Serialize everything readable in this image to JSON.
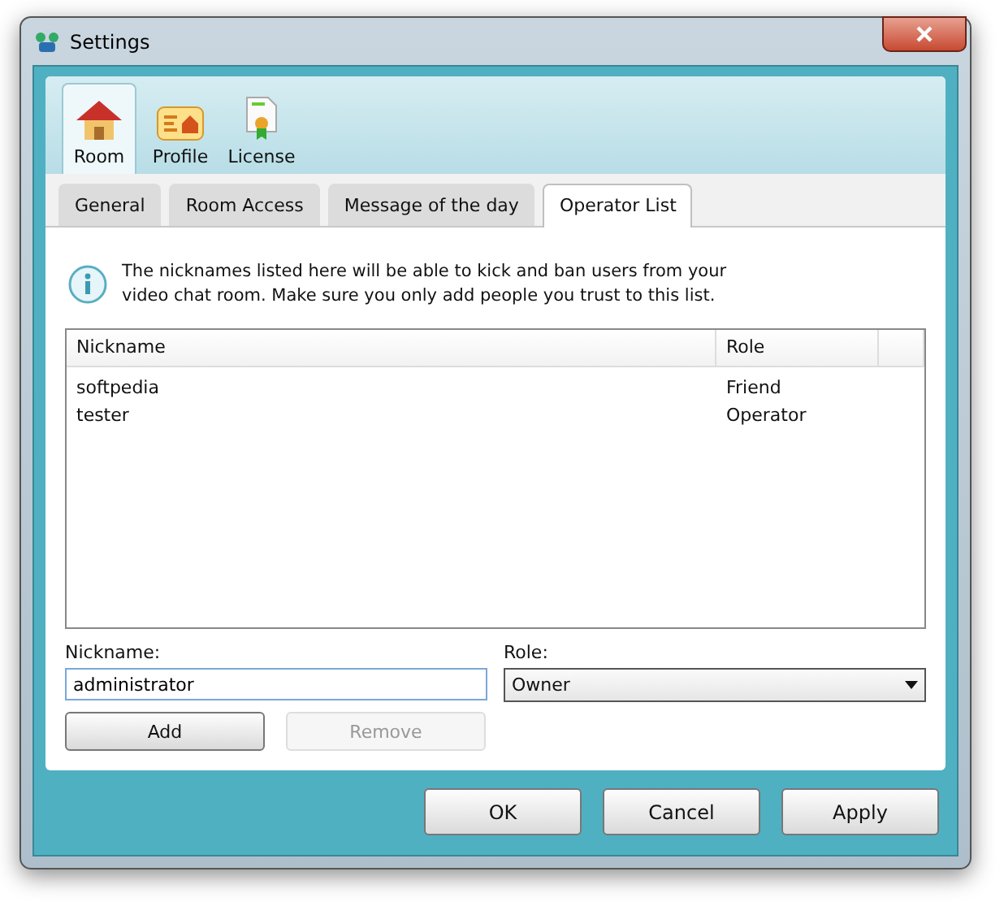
{
  "window": {
    "title": "Settings"
  },
  "categories": [
    {
      "label": "Room",
      "kind": "house",
      "selected": true
    },
    {
      "label": "Profile",
      "kind": "profile",
      "selected": false
    },
    {
      "label": "License",
      "kind": "license",
      "selected": false
    }
  ],
  "tabs": [
    {
      "label": "General",
      "selected": false
    },
    {
      "label": "Room Access",
      "selected": false
    },
    {
      "label": "Message of the day",
      "selected": false
    },
    {
      "label": "Operator List",
      "selected": true
    }
  ],
  "info": "The nicknames listed here will be able to kick and ban users from your video chat room. Make sure you only add people you trust to this list.",
  "table": {
    "columns": [
      "Nickname",
      "Role"
    ],
    "rows": [
      [
        "softpedia",
        "Friend"
      ],
      [
        "tester",
        "Operator"
      ]
    ]
  },
  "form": {
    "nickname_label": "Nickname:",
    "nickname_value": "administrator",
    "role_label": "Role:",
    "role_value": "Owner"
  },
  "form_buttons": [
    {
      "label": "Add",
      "disabled": false
    },
    {
      "label": "Remove",
      "disabled": true
    }
  ],
  "buttons": [
    "OK",
    "Cancel",
    "Apply"
  ]
}
